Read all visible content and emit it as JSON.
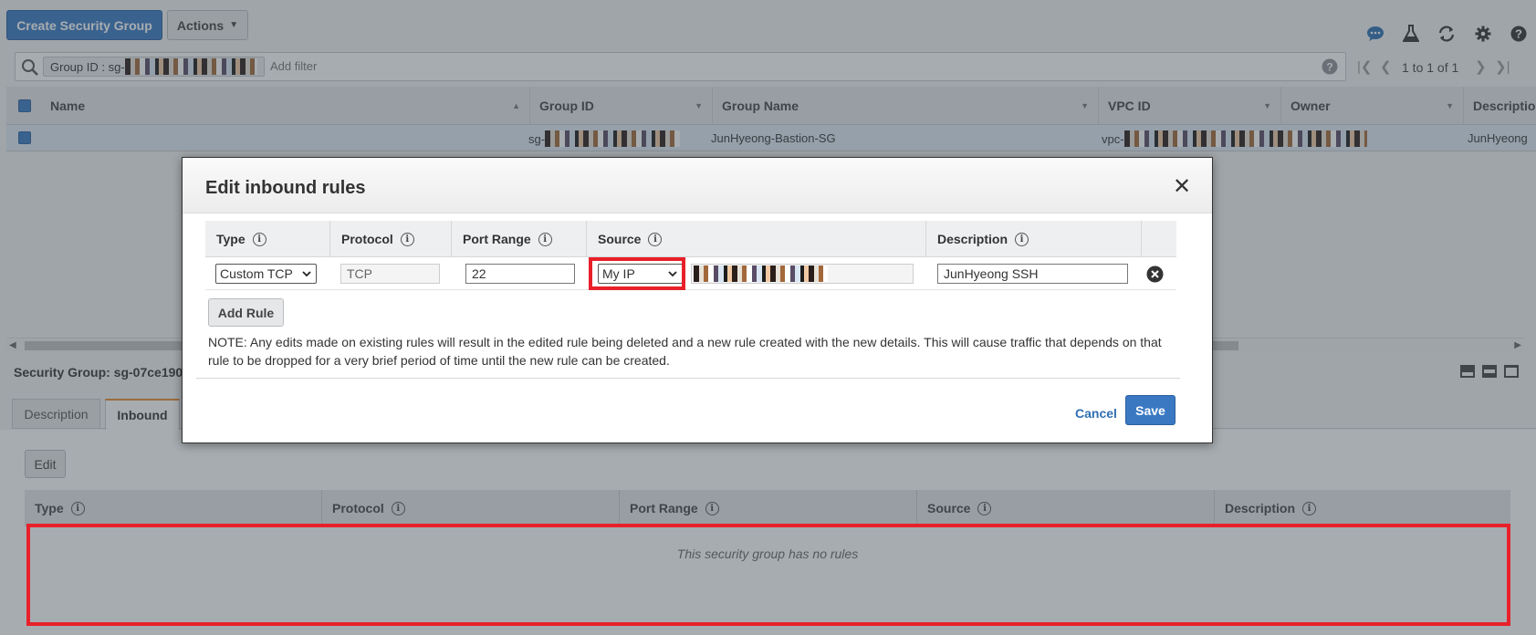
{
  "toolbar": {
    "create_label": "Create Security Group",
    "actions_label": "Actions",
    "icons": [
      "chat-icon",
      "flask-icon",
      "refresh-icon",
      "gear-icon",
      "help-icon"
    ]
  },
  "filter": {
    "chip_label": "Group ID : sg-",
    "placeholder": "Add filter",
    "pagination": "1 to 1 of 1"
  },
  "grid": {
    "columns": [
      "Name",
      "Group ID",
      "Group Name",
      "VPC ID",
      "Owner",
      "Description"
    ],
    "row": {
      "name": "",
      "group_id_prefix": "sg-",
      "group_name": "JunHyeong-Bastion-SG",
      "vpc_id_prefix": "vpc-",
      "owner": "",
      "description": "JunHyeong"
    }
  },
  "detail": {
    "title": "Security Group: sg-07ce190",
    "tabs": [
      "Description",
      "Inbound"
    ],
    "active_tab": "Inbound",
    "edit_label": "Edit",
    "columns": [
      "Type",
      "Protocol",
      "Port Range",
      "Source",
      "Description"
    ],
    "empty_message": "This security group has no rules"
  },
  "modal": {
    "title": "Edit inbound rules",
    "columns": [
      "Type",
      "Protocol",
      "Port Range",
      "Source",
      "Description"
    ],
    "rule": {
      "type": "Custom TCP",
      "protocol": "TCP",
      "port_range": "22",
      "source": "My IP",
      "description": "JunHyeong SSH"
    },
    "add_rule_label": "Add Rule",
    "note": "NOTE: Any edits made on existing rules will result in the edited rule being deleted and a new rule created with the new details. This will cause traffic that depends on that rule to be dropped for a very brief period of time until the new rule can be created.",
    "cancel_label": "Cancel",
    "save_label": "Save"
  },
  "colors": {
    "primary": "#3a78c2",
    "highlight": "#e8202a"
  }
}
